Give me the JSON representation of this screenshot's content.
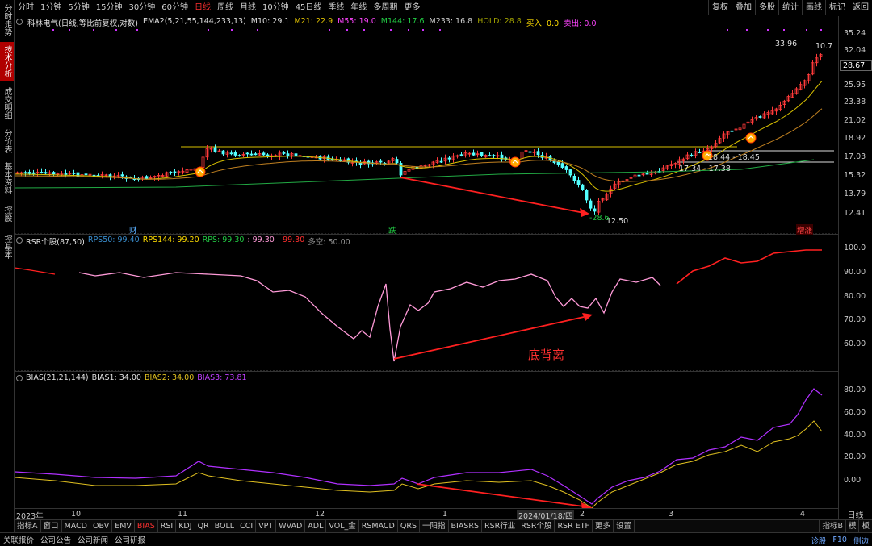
{
  "sidebar": {
    "tabs": [
      {
        "label": "分时走势",
        "active": false
      },
      {
        "label": "技术分析",
        "active": true
      },
      {
        "label": "成交明细",
        "active": false
      },
      {
        "label": "分价表",
        "active": false
      },
      {
        "label": "基本资料",
        "active": false
      },
      {
        "label": "控股",
        "active": false
      },
      {
        "label": "控基本",
        "active": false
      }
    ]
  },
  "toolbar": {
    "periods": [
      "分时",
      "1分钟",
      "5分钟",
      "15分钟",
      "30分钟",
      "60分钟",
      "日线",
      "周线",
      "月线",
      "10分钟",
      "45日线",
      "季线",
      "年线",
      "多周期",
      "更多"
    ],
    "active_period": "日线",
    "actions": [
      "复权",
      "叠加",
      "多股",
      "统计",
      "画线",
      "标记",
      "返回"
    ]
  },
  "main_legend": {
    "stock": "科林电气(日线,等比前复权,对数)",
    "ema": "EMA2(5,21,55,144,233,13)",
    "m10": "M10: 29.1",
    "m21": "M21: 22.9",
    "m55": "M55: 19.0",
    "m144": "M144: 17.6",
    "m233": "M233: 16.8",
    "hold": "HOLD: 28.8",
    "buy": "买入: 0.0",
    "sell": "卖出: 0.0"
  },
  "rsr_legend": {
    "name": "RSR个股(87,50)",
    "rps50": "RPS50: 99.40",
    "rps144": "RPS144: 99.20",
    "rps": "RPS: 99.30",
    "v1": ": 99.30",
    "v2": ": 99.30",
    "duokong": "多空: 50.00"
  },
  "bias_legend": {
    "name": "BIAS(21,21,144)",
    "bias1": "BIAS1: 34.00",
    "bias2": "BIAS2: 34.00",
    "bias3": "BIAS3: 73.81"
  },
  "main_axis": {
    "labels": [
      "35.24",
      "32.04",
      "28.67",
      "25.95",
      "23.38",
      "21.02",
      "18.92",
      "17.03",
      "15.32",
      "13.79",
      "12.41"
    ],
    "last_price": "28.67"
  },
  "rsr_axis": {
    "labels": [
      "100.0",
      "90.00",
      "80.00",
      "70.00",
      "60.00"
    ]
  },
  "bias_axis": {
    "labels": [
      "80.00",
      "60.00",
      "40.00",
      "20.00",
      "0.00"
    ]
  },
  "annotations": {
    "high": "33.96",
    "high2": "10.7",
    "low": "12.50",
    "low_tag": "-28.6",
    "range1": "18.44 - 18.45",
    "range2": "17.34 - 17.38",
    "divergence": "底背离",
    "tag_cai": "财",
    "tag_die": "跌",
    "tag_zhang": "增涨"
  },
  "x_axis": {
    "labels": [
      "2023年",
      "10",
      "11",
      "12",
      "1",
      "2",
      "3",
      "4"
    ],
    "cursor_date": "2024/01/18/四",
    "corner": "日线"
  },
  "indicator_tabs": {
    "items": [
      "指标A",
      "窗口",
      "MACD",
      "OBV",
      "EMV",
      "BIAS",
      "RSI",
      "KDJ",
      "QR",
      "BOLL",
      "CCI",
      "VPT",
      "WVAD",
      "ADL",
      "VOL_金",
      "RSMACD",
      "QRS",
      "一阳指",
      "BIASRS",
      "RSR行业",
      "RSR个股",
      "RSR ETF",
      "更多",
      "设置"
    ],
    "active": "BIAS",
    "right": [
      "指标B",
      "模",
      "板"
    ]
  },
  "bottom_bar": {
    "items": [
      "关联报价",
      "公司公告",
      "公司新闻",
      "公司研报"
    ],
    "right": [
      "诊股",
      "F10",
      "侧边"
    ]
  },
  "colors": {
    "up": "#ff3a3a",
    "down": "#54ffff",
    "ma_yellow": "#d8c000",
    "ma_green": "#22aa44",
    "rsr_pink": "#ff9ad8",
    "rsr_red": "#ff2020",
    "bias_yellow": "#e0c020",
    "bias_purple": "#b030ff",
    "arrow": "#ff2020"
  }
}
